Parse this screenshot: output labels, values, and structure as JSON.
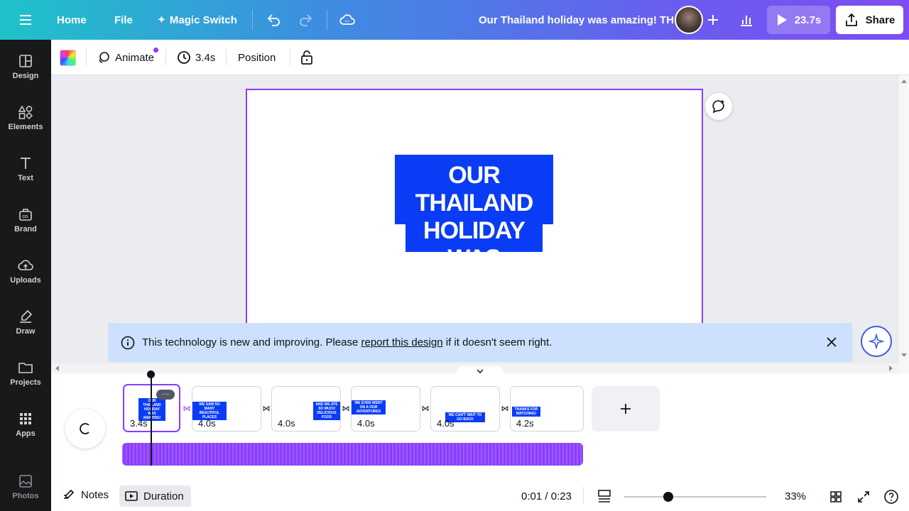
{
  "topbar": {
    "home": "Home",
    "file": "File",
    "magic_switch": "Magic Switch",
    "design_title": "Our Thailand holiday was amazing! TH",
    "play_duration": "23.7s",
    "share": "Share"
  },
  "sidebar": {
    "items": [
      {
        "label": "Design",
        "icon": "design-icon"
      },
      {
        "label": "Elements",
        "icon": "elements-icon"
      },
      {
        "label": "Text",
        "icon": "text-icon"
      },
      {
        "label": "Brand",
        "icon": "brand-icon"
      },
      {
        "label": "Uploads",
        "icon": "uploads-icon"
      },
      {
        "label": "Draw",
        "icon": "draw-icon"
      },
      {
        "label": "Projects",
        "icon": "projects-icon"
      },
      {
        "label": "Apps",
        "icon": "apps-icon"
      },
      {
        "label": "Photos",
        "icon": "photos-icon"
      }
    ]
  },
  "toolbar": {
    "animate": "Animate",
    "duration": "3.4s",
    "position": "Position"
  },
  "canvas": {
    "headline": "OUR THAILAND\nHOLIDAY WAS\nAMAZING!"
  },
  "banner": {
    "text_before": "This technology is new and improving. Please ",
    "link": "report this design",
    "text_after": " if it doesn't seem right."
  },
  "timeline": {
    "pages": [
      {
        "duration": "3.4s",
        "preview": "OUR THAILAND HOLIDAY WAS AMAZING!",
        "selected": true
      },
      {
        "duration": "4.0s",
        "preview": "WE SAW SO MANY BEAUTIFUL PLACES"
      },
      {
        "duration": "4.0s",
        "preview": "AND WE ATE SO MUCH DELICIOUS FOOD"
      },
      {
        "duration": "4.0s",
        "preview": "WE EVEN WENT ON A FEW ADVENTURES"
      },
      {
        "duration": "4.0s",
        "preview": "WE CAN'T WAIT TO GO BACK"
      },
      {
        "duration": "4.2s",
        "preview": "THANKS FOR WATCHING!"
      }
    ],
    "more_label": "···"
  },
  "footer": {
    "notes": "Notes",
    "duration": "Duration",
    "time": "0:01 / 0:23",
    "zoom": "33%",
    "zoom_level": 0.33
  },
  "colors": {
    "accent": "#8b3dff",
    "headline_bg": "#0a3cf5",
    "banner_bg": "#cde0fd"
  }
}
